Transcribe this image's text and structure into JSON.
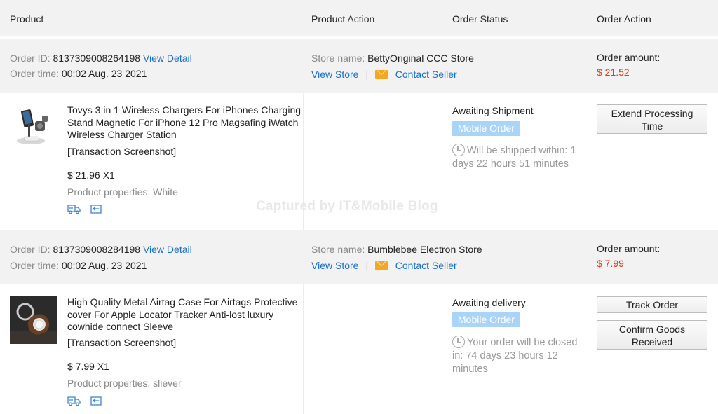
{
  "columns": {
    "product": "Product",
    "product_action": "Product Action",
    "order_status": "Order Status",
    "order_action": "Order Action"
  },
  "labels": {
    "order_id": "Order ID:",
    "order_time": "Order time:",
    "view_detail": "View Detail",
    "store_name": "Store name:",
    "view_store": "View Store",
    "separator": "|",
    "contact_seller": "Contact Seller",
    "order_amount": "Order amount:",
    "transaction_screenshot": "[Transaction Screenshot]"
  },
  "orders": [
    {
      "id": "8137309008264198",
      "time": "00:02 Aug. 23 2021",
      "store": "BettyOriginal CCC Store",
      "amount": "$ 21.52",
      "product_title": "Tovys 3 in 1 Wireless Chargers For iPhones Charging Stand Magnetic For iPhone 12 Pro Magsafing iWatch Wireless Charger Station",
      "price_qty": "$ 21.96 X1",
      "properties": "Product properties: White",
      "status": "Awaiting Shipment",
      "badge": "Mobile Order",
      "countdown": "Will be shipped within: 1 days 22 hours 51 minutes",
      "actions": [
        "Extend Processing Time"
      ]
    },
    {
      "id": "8137309008284198",
      "time": "00:02 Aug. 23 2021",
      "store": "Bumblebee Electron Store",
      "amount": "$ 7.99",
      "product_title": "High Quality Metal Airtag Case For Airtags Protective cover For Apple Locator Tracker Anti-lost luxury cowhide connect Sleeve",
      "price_qty": "$ 7.99 X1",
      "properties": "Product properties: sliever",
      "status": "Awaiting delivery",
      "badge": "Mobile Order",
      "countdown": "Your order will be closed in: 74 days 23 hours 12 minutes",
      "actions": [
        "Track Order",
        "Confirm Goods Received"
      ]
    }
  ],
  "watermark": "Captured by IT&Mobile Blog",
  "colors": {
    "link": "#1a6fc9",
    "amount": "#e23a12",
    "badge": "#a9d4f7",
    "header_bg": "#f2f2f2",
    "mail_icon": "#f5a623"
  }
}
